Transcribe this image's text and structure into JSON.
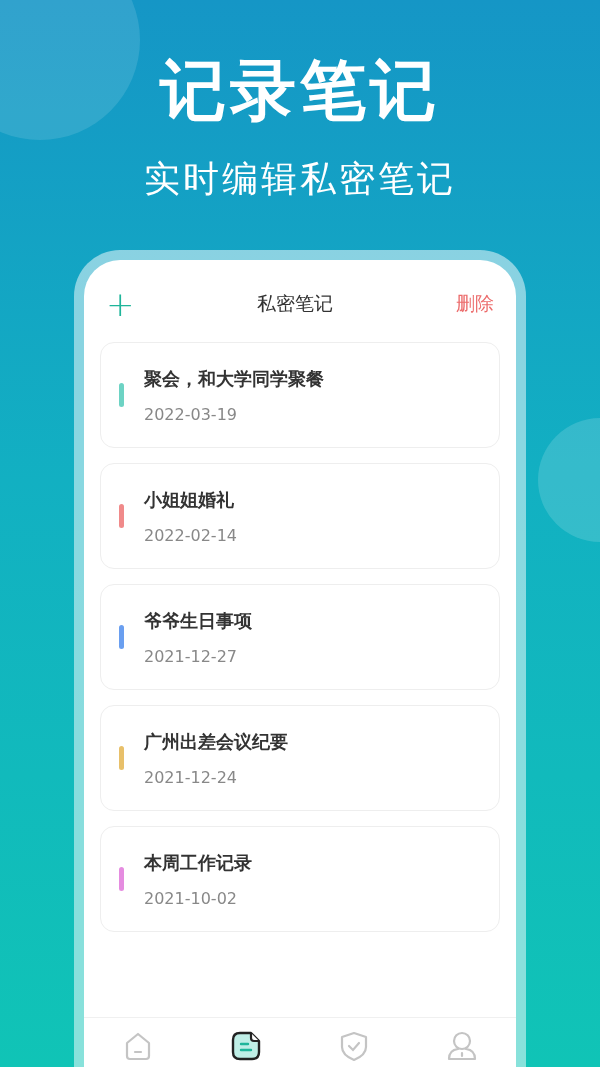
{
  "headline": "记录笔记",
  "subtitle": "实时编辑私密笔记",
  "app": {
    "title": "私密笔记",
    "add_button": "+",
    "delete_button": "删除"
  },
  "notes": [
    {
      "title": "聚会，和大学同学聚餐",
      "date": "2022-03-19",
      "color": "#6dd3c4"
    },
    {
      "title": "小姐姐婚礼",
      "date": "2022-02-14",
      "color": "#f08a8a"
    },
    {
      "title": "爷爷生日事项",
      "date": "2021-12-27",
      "color": "#6a9ff0"
    },
    {
      "title": "广州出差会议纪要",
      "date": "2021-12-24",
      "color": "#e8c06a"
    },
    {
      "title": "本周工作记录",
      "date": "2021-10-02",
      "color": "#e58ce0"
    }
  ],
  "tab_bar": [
    {
      "kind": "home",
      "selected": false
    },
    {
      "kind": "notes",
      "selected": true
    },
    {
      "kind": "shield",
      "selected": false
    },
    {
      "kind": "profile",
      "selected": false
    }
  ]
}
